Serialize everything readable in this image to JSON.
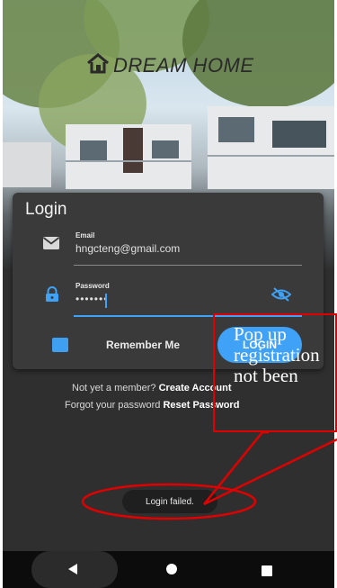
{
  "app": {
    "brand": "DREAM HOME"
  },
  "login": {
    "title": "Login",
    "email": {
      "label": "Email",
      "value": "hngcteng@gmail.com"
    },
    "password": {
      "label": "Password",
      "value": "•••••••"
    },
    "remember_label": "Remember Me",
    "login_button": "LOGIN",
    "member_prompt": "Not yet a member?",
    "create_account": "Create Account",
    "forgot_prompt": "Forgot your password",
    "reset_password": "Reset Password"
  },
  "toast": {
    "message": "Login failed."
  },
  "annotation": {
    "lines": [
      "Pop    up",
      "registration",
      "not been"
    ]
  },
  "icons": {
    "brand": "house-icon",
    "email": "mail-icon",
    "password": "lock-icon",
    "visibility": "eye-off-icon",
    "nav_back": "back-triangle-icon",
    "nav_home": "home-circle-icon",
    "nav_recent": "recents-square-icon"
  },
  "colors": {
    "accent": "#3fa2f6",
    "card": "#3a3a3a",
    "screen_bg": "#2f2f2f",
    "annotation": "#e00000"
  }
}
